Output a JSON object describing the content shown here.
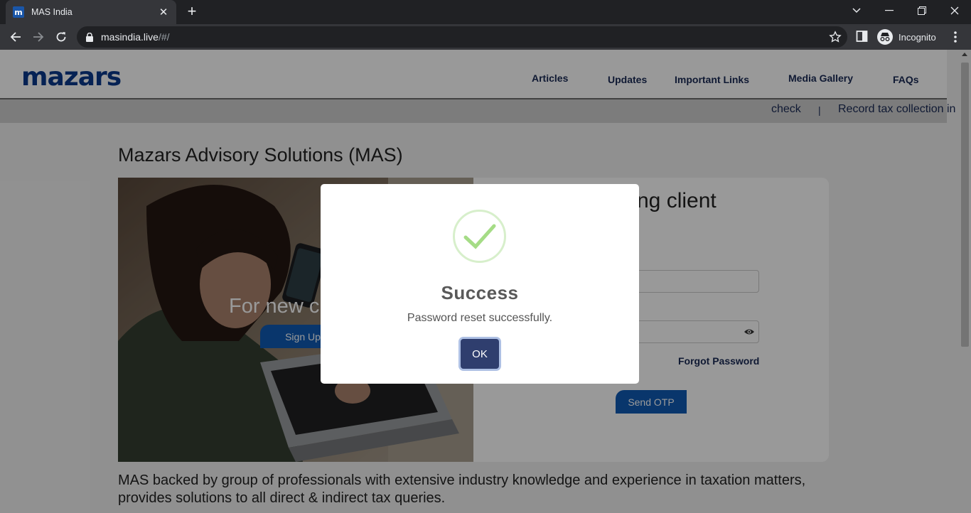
{
  "browser": {
    "tab_title": "MAS India",
    "favicon_letter": "m",
    "url_host": "masindia.live",
    "url_path": "/#/",
    "profile_label": "Incognito"
  },
  "header": {
    "logo_text": "mazars",
    "nav": [
      "Articles",
      "Updates",
      "Important Links",
      "Media Gallery",
      "FAQs"
    ]
  },
  "ticker": {
    "items": [
      "check",
      "|",
      "Record tax collection in"
    ]
  },
  "main": {
    "title": "Mazars Advisory Solutions (MAS)",
    "hero_text": "For new c",
    "signup_label": "Sign Up",
    "card_title": "sting client",
    "forgot_label": "Forgot Password",
    "send_otp_label": "Send OTP",
    "description": "MAS backed by group of professionals with extensive industry knowledge and experience in taxation matters, provides solutions to all direct & indirect tax queries."
  },
  "modal": {
    "title": "Success",
    "message": "Password reset successfully.",
    "ok_label": "OK"
  },
  "colors": {
    "brand": "#0a3a8c",
    "button": "#0f5bb5",
    "ok_button": "#2f3e6e",
    "success_green": "#a5dc86"
  }
}
